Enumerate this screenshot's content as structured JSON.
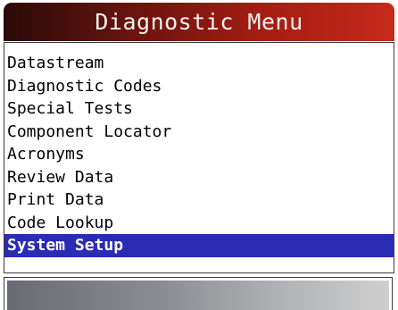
{
  "header": {
    "title": "Diagnostic Menu"
  },
  "menu": {
    "items": [
      {
        "label": "Datastream"
      },
      {
        "label": "Diagnostic Codes"
      },
      {
        "label": "Special Tests"
      },
      {
        "label": "Component Locator"
      },
      {
        "label": "Acronyms"
      },
      {
        "label": "Review Data"
      },
      {
        "label": "Print Data"
      },
      {
        "label": "Code Lookup"
      },
      {
        "label": "System Setup"
      }
    ],
    "selected_index": 8
  },
  "colors": {
    "title_gradient_start": "#2a0a08",
    "title_gradient_end": "#c72a1a",
    "selection_bg": "#2b2cb4",
    "selection_text": "#ffffff"
  }
}
